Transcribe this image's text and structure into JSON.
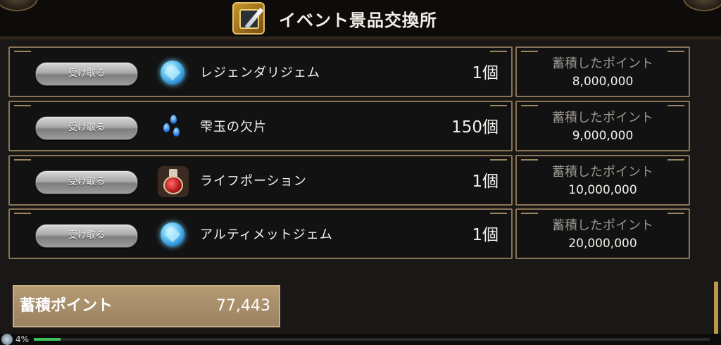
{
  "header": {
    "title": "イベント景品交換所",
    "icon": "event-shop-icon"
  },
  "rewards": [
    {
      "button_label": "受け取る",
      "icon": "blue-gem-icon",
      "name": "レジェンダリジェム",
      "quantity": "1個",
      "points_label": "蓄積したポイント",
      "points": "8,000,000"
    },
    {
      "button_label": "受け取る",
      "icon": "water-drops-icon",
      "name": "雫玉の欠片",
      "quantity": "150個",
      "points_label": "蓄積したポイント",
      "points": "9,000,000"
    },
    {
      "button_label": "受け取る",
      "icon": "potion-icon",
      "name": "ライフポーション",
      "quantity": "1個",
      "points_label": "蓄積したポイント",
      "points": "10,000,000"
    },
    {
      "button_label": "受け取る",
      "icon": "blue-gem-icon",
      "name": "アルティメットジェム",
      "quantity": "1個",
      "points_label": "蓄積したポイント",
      "points": "20,000,000"
    }
  ],
  "total": {
    "label": "蓄積ポイント",
    "value": "77,443"
  },
  "footer": {
    "percent": "4%",
    "progress": 0.04
  },
  "colors": {
    "frame": "#8a7458",
    "total_box": "#b59a73",
    "progress": "#3fbf5b"
  }
}
